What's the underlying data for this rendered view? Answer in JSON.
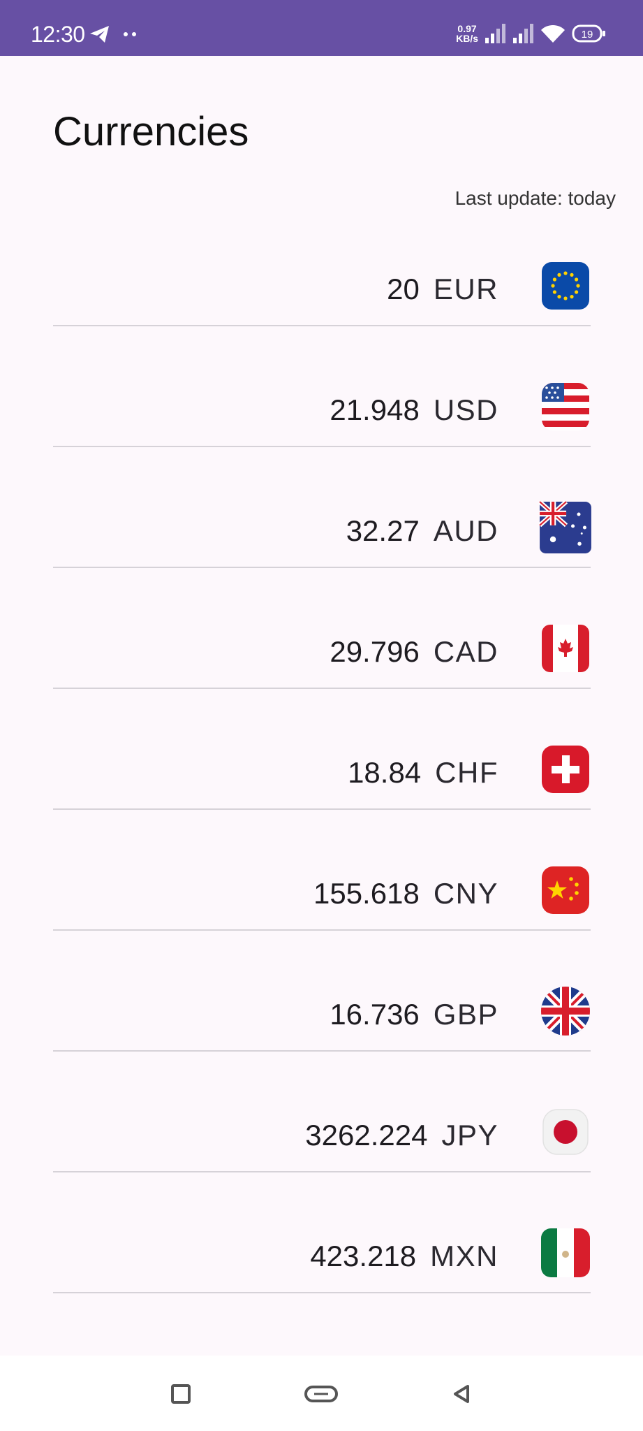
{
  "status_bar": {
    "time": "12:30",
    "net_speed_value": "0.97",
    "net_speed_unit": "KB/s",
    "battery": "19",
    "icons": [
      "telegram-icon",
      "more-dots-icon",
      "signal-icon",
      "signal-icon",
      "wifi-icon",
      "battery-icon"
    ]
  },
  "header": {
    "title": "Currencies",
    "last_update": "Last update: today"
  },
  "currencies": [
    {
      "amount": "20",
      "code": "EUR",
      "flag": "eu-flag-icon"
    },
    {
      "amount": "21.948",
      "code": "USD",
      "flag": "us-flag-icon"
    },
    {
      "amount": "32.27",
      "code": "AUD",
      "flag": "au-flag-icon"
    },
    {
      "amount": "29.796",
      "code": "CAD",
      "flag": "ca-flag-icon"
    },
    {
      "amount": "18.84",
      "code": "CHF",
      "flag": "ch-flag-icon"
    },
    {
      "amount": "155.618",
      "code": "CNY",
      "flag": "cn-flag-icon"
    },
    {
      "amount": "16.736",
      "code": "GBP",
      "flag": "gb-flag-icon"
    },
    {
      "amount": "3262.224",
      "code": "JPY",
      "flag": "jp-flag-icon"
    },
    {
      "amount": "423.218",
      "code": "MXN",
      "flag": "mx-flag-icon"
    }
  ],
  "nav_bar": {
    "buttons": [
      "recents-square-icon",
      "home-pill-icon",
      "back-triangle-icon"
    ]
  },
  "colors": {
    "status_bar": "#6750a4",
    "background": "#fdf8fc",
    "divider": "#d6d2d8"
  }
}
